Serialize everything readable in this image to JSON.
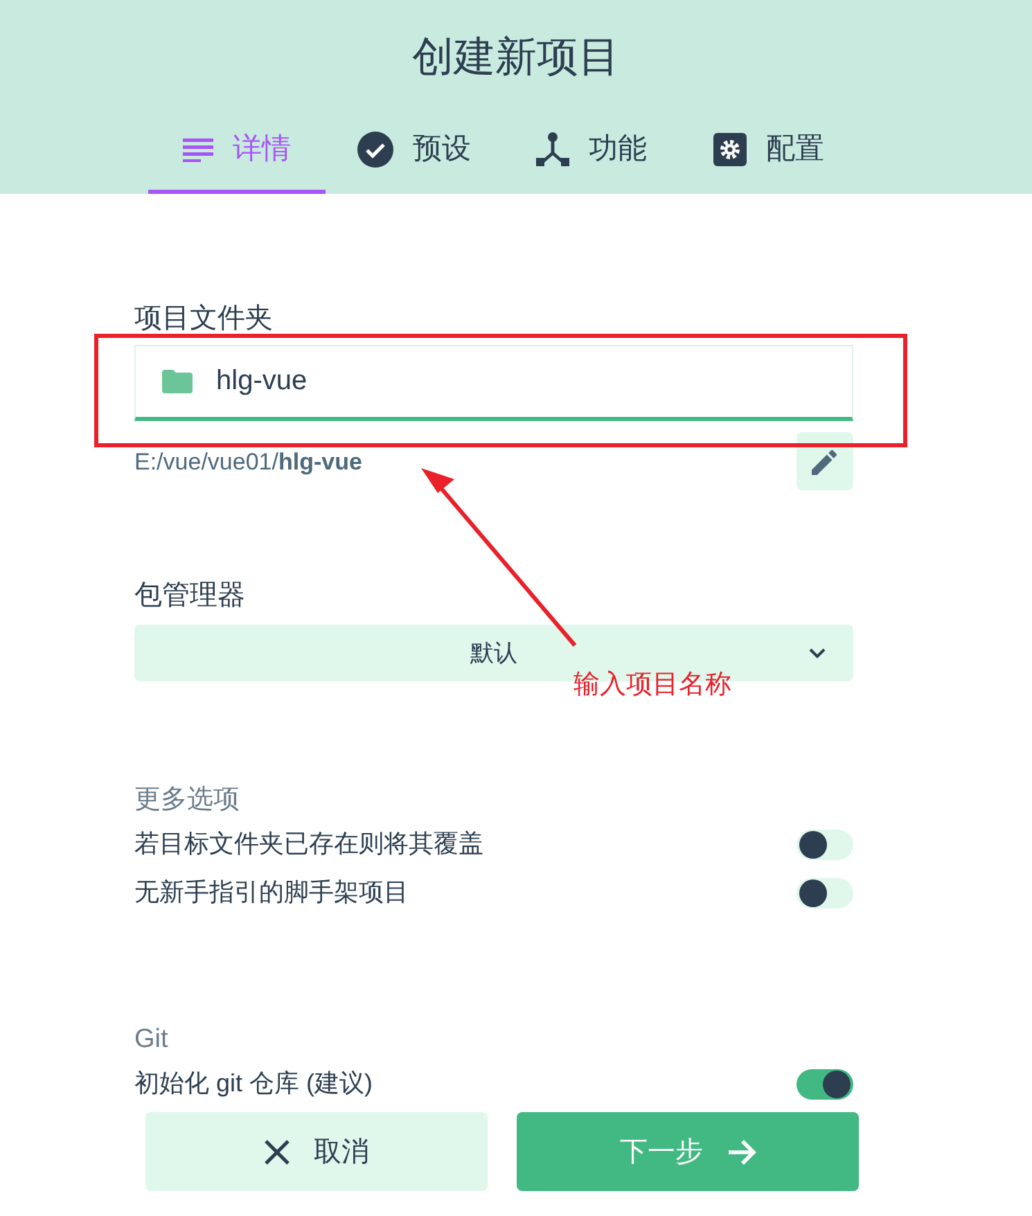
{
  "title": "创建新项目",
  "tabs": [
    {
      "label": "详情",
      "kind": "details",
      "selected": true
    },
    {
      "label": "预设",
      "kind": "check",
      "selected": false
    },
    {
      "label": "功能",
      "kind": "fork",
      "selected": false
    },
    {
      "label": "配置",
      "kind": "gear",
      "selected": false
    }
  ],
  "folder": {
    "label": "项目文件夹",
    "value": "hlg-vue",
    "path": "E:/vue/vue01/**hlg-vue**"
  },
  "package_manager": {
    "label": "包管理器",
    "value": "默认"
  },
  "more_options": {
    "label": "更多选项",
    "items": [
      {
        "label": "若目标文件夹已存在则将其覆盖",
        "on": false
      },
      {
        "label": "无新手指引的脚手架项目",
        "on": false
      }
    ]
  },
  "git": {
    "label": "Git",
    "items": [
      {
        "label": "初始化 git 仓库 (建议)",
        "on": true
      }
    ]
  },
  "buttons": [
    {
      "label": "取消",
      "kind": "cancel"
    },
    {
      "label": "下一步",
      "kind": "next"
    }
  ],
  "annotation": {
    "text": "输入项目名称"
  }
}
